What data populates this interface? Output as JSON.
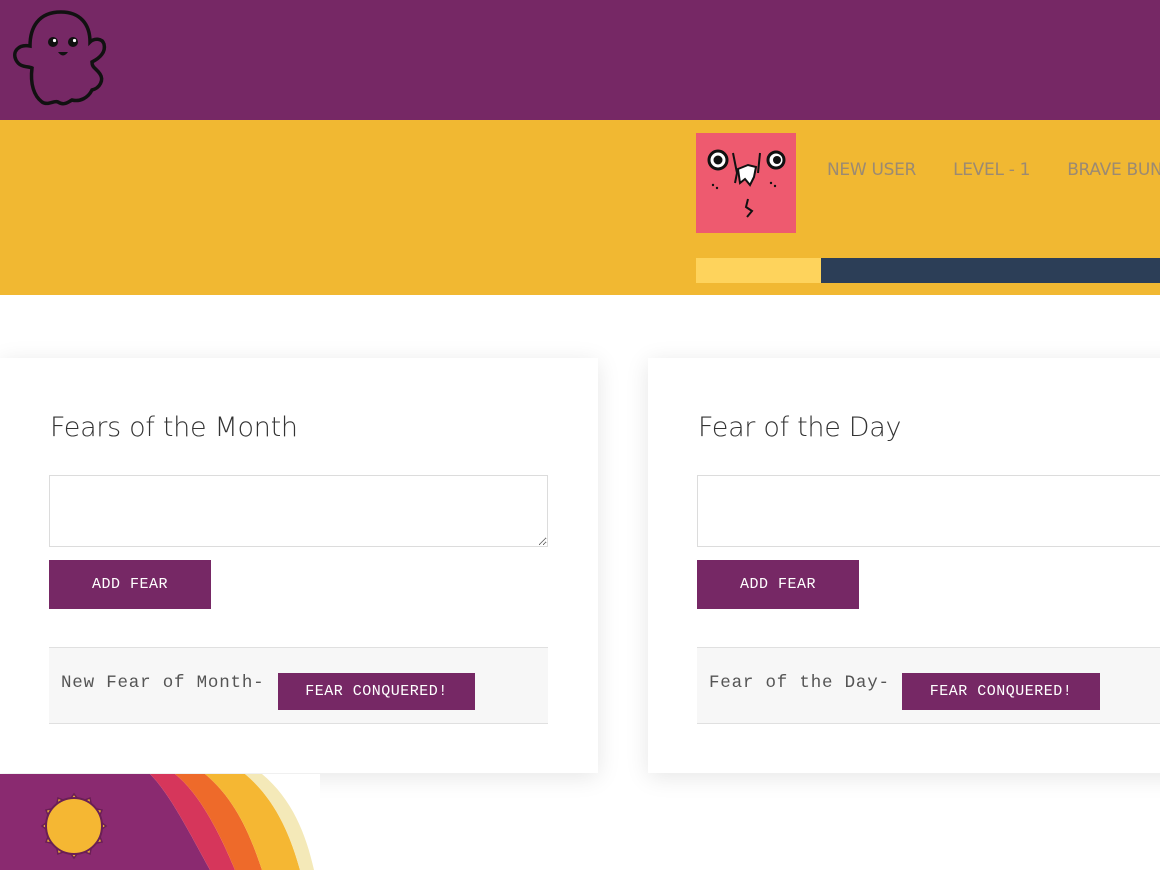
{
  "header": {
    "logo_icon": "ghost-icon",
    "brand_color": "#762865"
  },
  "profile": {
    "avatar_icon": "funny-face-icon",
    "avatar_color": "#ee5a6f",
    "items": [
      "NEW USER",
      "LEVEL - 1",
      "BRAVE BUNNY"
    ],
    "progress": 0.27,
    "progress_color": "#fed35c",
    "band_color": "#f1b832"
  },
  "cards": {
    "month": {
      "title": "Fears of the Month",
      "input_value": "",
      "add_label": "ADD FEAR",
      "fear_text": "New Fear of Month-",
      "conquer_label": "FEAR CONQUERED!"
    },
    "day": {
      "title": "Fear of the Day",
      "input_value": "",
      "add_label": "ADD FEAR",
      "fear_text": "Fear of the Day-",
      "conquer_label": "FEAR CONQUERED!"
    }
  },
  "decor": {
    "sun_icon": "sun-icon"
  }
}
